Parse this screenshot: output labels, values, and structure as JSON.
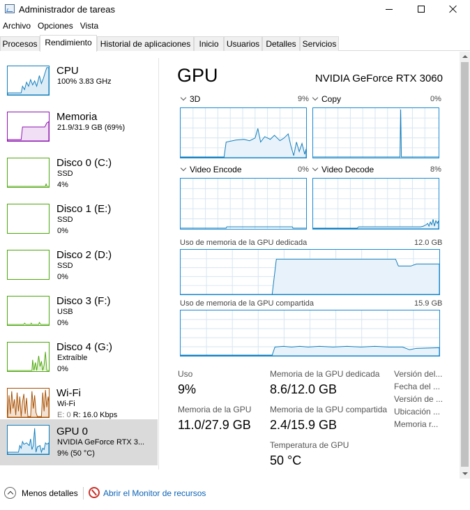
{
  "window": {
    "title": "Administrador de tareas"
  },
  "menu": [
    "Archivo",
    "Opciones",
    "Vista"
  ],
  "tabs": [
    "Procesos",
    "Rendimiento",
    "Historial de aplicaciones",
    "Inicio",
    "Usuarios",
    "Detalles",
    "Servicios"
  ],
  "active_tab": "Rendimiento",
  "sidebar": {
    "items": [
      {
        "title": "CPU",
        "line1": "100%  3.83 GHz",
        "line2": "",
        "color": "#117dbb"
      },
      {
        "title": "Memoria",
        "line1": "21.9/31.9 GB (69%)",
        "line2": "",
        "color": "#8b12ae"
      },
      {
        "title": "Disco 0 (C:)",
        "line1": "SSD",
        "line2": "4%",
        "color": "#4da60c"
      },
      {
        "title": "Disco 1 (E:)",
        "line1": "SSD",
        "line2": "0%",
        "color": "#4da60c"
      },
      {
        "title": "Disco 2 (D:)",
        "line1": "SSD",
        "line2": "0%",
        "color": "#4da60c"
      },
      {
        "title": "Disco 3 (F:)",
        "line1": "USB",
        "line2": "0%",
        "color": "#4da60c"
      },
      {
        "title": "Disco 4 (G:)",
        "line1": "Extraíble",
        "line2": "0%",
        "color": "#4da60c"
      },
      {
        "title": "Wi-Fi",
        "line1": "Wi-Fi",
        "line2_prefix": "E: 0 ",
        "line2": "R: 16.0 Kbps",
        "color": "#a74f01"
      },
      {
        "title": "GPU 0",
        "line1": "NVIDIA GeForce RTX 3...",
        "line2": "9% (50 °C)",
        "color": "#117dbb"
      }
    ]
  },
  "main": {
    "title": "GPU",
    "model": "NVIDIA GeForce RTX 3060",
    "engines": [
      {
        "name": "3D",
        "pct": "9%"
      },
      {
        "name": "Copy",
        "pct": "0%"
      },
      {
        "name": "Video Encode",
        "pct": "0%"
      },
      {
        "name": "Video Decode",
        "pct": "8%"
      }
    ],
    "dedicated_label": "Uso de memoria de la GPU dedicada",
    "dedicated_max": "12.0 GB",
    "shared_label": "Uso de memoria de la GPU compartida",
    "shared_max": "15.9 GB",
    "stats": {
      "uso_label": "Uso",
      "uso_value": "9%",
      "gpu_mem_label": "Memoria de la GPU",
      "gpu_mem_value": "11.0/27.9 GB",
      "ded_label": "Memoria de la GPU dedicada",
      "ded_value": "8.6/12.0 GB",
      "shared_label": "Memoria de la GPU compartida",
      "shared_value": "2.4/15.9 GB",
      "temp_label": "Temperatura de GPU",
      "temp_value": "50 °C"
    },
    "keys": [
      "Versión del...",
      "Fecha del ...",
      "Versión de ...",
      "Ubicación ...",
      "Memoria r..."
    ]
  },
  "footer": {
    "less_details": "Menos detalles",
    "resource_monitor": "Abrir el Monitor de recursos"
  },
  "colors": {
    "gpu": "#117dbb",
    "memory": "#8b12ae",
    "disk": "#4da60c",
    "wifi": "#a74f01",
    "link": "#0b63b6"
  },
  "icons": {
    "app": "task-manager-icon",
    "less": "chevron-up-circle-icon",
    "resmon": "resource-monitor-icon"
  }
}
